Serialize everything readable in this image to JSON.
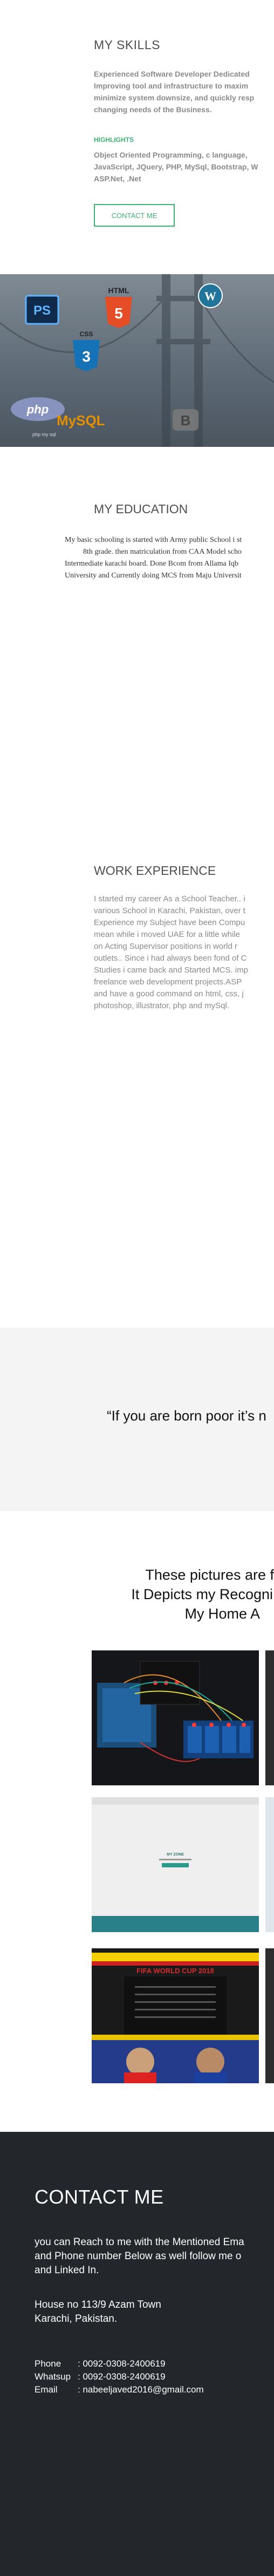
{
  "skills": {
    "title": "MY SKILLS",
    "lines": [
      "Experienced Software Developer Dedicated",
      "Improving tool and infrastructure to maxim",
      "minimize system downsize, and quickly resp",
      "changing needs of the Business."
    ],
    "highlights_label": "HIGHLIGHTS",
    "highlights_lines": [
      "Object Oriented Programming, c language,",
      "JavaScript, JQuery, PHP, MySql, Bootstrap, W",
      "ASP.Net, .Net"
    ],
    "contact_button": "CONTACT ME"
  },
  "banner": {
    "logos": [
      "PS",
      "HTML",
      "5",
      "CSS",
      "3",
      "php",
      "MySQL",
      "B",
      "WordPress"
    ],
    "caption": "php my sql"
  },
  "education": {
    "title": "MY EDUCATION",
    "lines": [
      "My basic schooling is started with Army public School i st",
      "8th grade. then matriculation from CAA Model scho",
      "Intermediate karachi board. Done Bcom from Allama Iqb",
      "University and Currently doing MCS from Maju Universit"
    ]
  },
  "work": {
    "title": "WORK EXPERIENCE",
    "lines": [
      "I started my career As a School Teacher.. i",
      "various School in Karachi, Pakistan, over t",
      "Experience my Subject have been  Compu",
      "mean while i moved UAE for a little while",
      "on Acting Supervisor positions in world r",
      "outlets.. Since i had always been fond of C",
      "Studies i came back and Started MCS. imp",
      "freelance web development projects.ASP",
      "and have a good command on html, css, j",
      "photoshop, illustrator, php and mySql."
    ]
  },
  "quote": {
    "text": "“If you are born poor it’s n"
  },
  "gallery": {
    "title_lines": [
      "These pictures are f",
      "It Depicts my Recogni",
      "My Home A"
    ],
    "photo2_caption": "MY ZONE",
    "photo3_banner": "FIFA WORLD CUP 2018"
  },
  "contact": {
    "title": "CONTACT ME",
    "lines": [
      "you can Reach to me with the Mentioned Ema",
      "and Phone number Below as well follow me o",
      "and Linked In."
    ],
    "address_lines": [
      "House no 113/9 Azam Town",
      "Karachi, Pakistan."
    ],
    "phone_label": "Phone",
    "phone_value": ":  0092-0308-2400619",
    "whatsup_label": "Whatsup",
    "whatsup_value": ":  0092-0308-2400619",
    "email_label": "Email",
    "email_value": ":  nabeeljaved2016@gmail.com"
  }
}
